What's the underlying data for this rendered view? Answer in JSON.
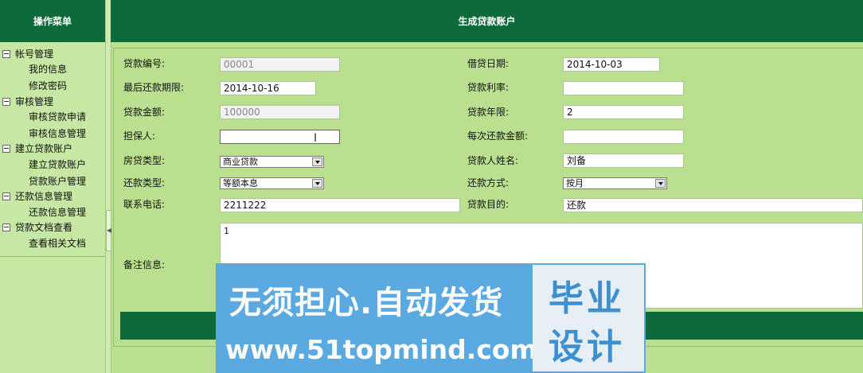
{
  "sidebar": {
    "title": "操作菜单",
    "groups": [
      {
        "label": "帐号管理",
        "items": [
          "我的信息",
          "修改密码"
        ]
      },
      {
        "label": "审核管理",
        "items": [
          "审核贷款申请",
          "审核信息管理"
        ]
      },
      {
        "label": "建立贷款账户",
        "items": [
          "建立贷款账户",
          "贷款账户管理"
        ]
      },
      {
        "label": "还款信息管理",
        "items": [
          "还款信息管理"
        ]
      },
      {
        "label": "贷款文档查看",
        "items": [
          "查看相关文档"
        ]
      }
    ]
  },
  "content": {
    "title": "生成贷款账户"
  },
  "form": {
    "loan_no": {
      "label": "贷款编号:",
      "value": "00001"
    },
    "borrow_date": {
      "label": "借贷日期:",
      "value": "2014-10-03"
    },
    "deadline": {
      "label": "最后还款期限:",
      "value": "2014-10-16"
    },
    "rate": {
      "label": "贷款利率:",
      "value": ""
    },
    "amount": {
      "label": "贷款金额:",
      "value": "100000"
    },
    "years": {
      "label": "贷款年限:",
      "value": "2"
    },
    "guarantor": {
      "label": "担保人:",
      "value": ""
    },
    "per_payment": {
      "label": "每次还款金额:",
      "value": ""
    },
    "house_type": {
      "label": "房贷类型:",
      "value": "商业贷款"
    },
    "borrower_name": {
      "label": "贷款人姓名:",
      "value": "刘备"
    },
    "repay_type": {
      "label": "还款类型:",
      "value": "等额本息"
    },
    "repay_method": {
      "label": "还款方式:",
      "value": "按月"
    },
    "phone": {
      "label": "联系电话:",
      "value": "2211222"
    },
    "purpose": {
      "label": "贷款目的:",
      "value": "还款"
    },
    "remark": {
      "label": "备注信息:",
      "value": "1"
    }
  },
  "watermark": {
    "line1": "无须担心.自动发货",
    "line2": "www.51topmind.com",
    "badge_line1": "毕业",
    "badge_line2": "设计"
  },
  "colors": {
    "header_green": "#0d6a3a",
    "panel_green": "#b9df8f",
    "watermark_blue": "#5aa9e0"
  }
}
